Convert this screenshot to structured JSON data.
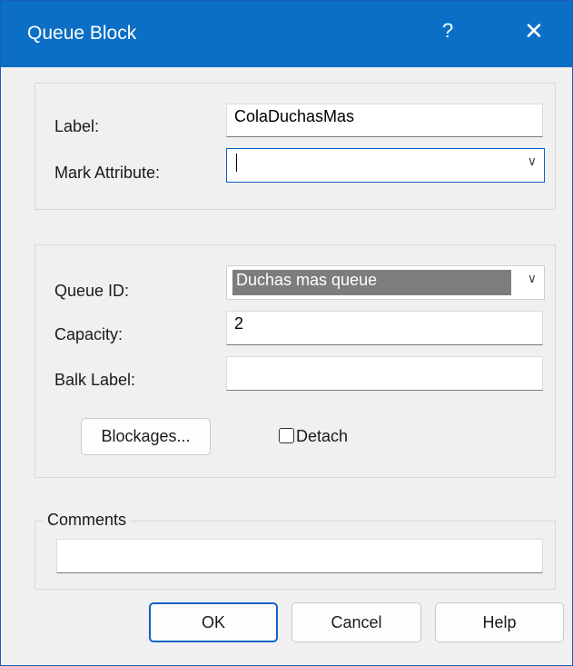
{
  "window": {
    "title": "Queue Block",
    "help_glyph": "?",
    "close_glyph": "✕"
  },
  "block_group": {
    "label_caption": "Label:",
    "label_value": "ColaDuchasMas",
    "mark_attr_caption": "Mark Attribute:",
    "mark_attr_value": ""
  },
  "queue_group": {
    "queue_id_caption": "Queue ID:",
    "queue_id_value": "Duchas mas queue",
    "capacity_caption": "Capacity:",
    "capacity_value": "2",
    "balk_caption": "Balk Label:",
    "balk_value": "",
    "blockages_label": "Blockages...",
    "detach_label": "Detach",
    "detach_checked": false
  },
  "comments": {
    "legend": "Comments",
    "value": ""
  },
  "buttons": {
    "ok": "OK",
    "cancel": "Cancel",
    "help": "Help"
  },
  "icons": {
    "chevron": "chevron-down-icon",
    "close": "close-icon",
    "help": "help-icon"
  },
  "colors": {
    "titlebar": "#0b6fc5",
    "focus_border": "#0b63c6",
    "selection": "#7d7d7d"
  }
}
